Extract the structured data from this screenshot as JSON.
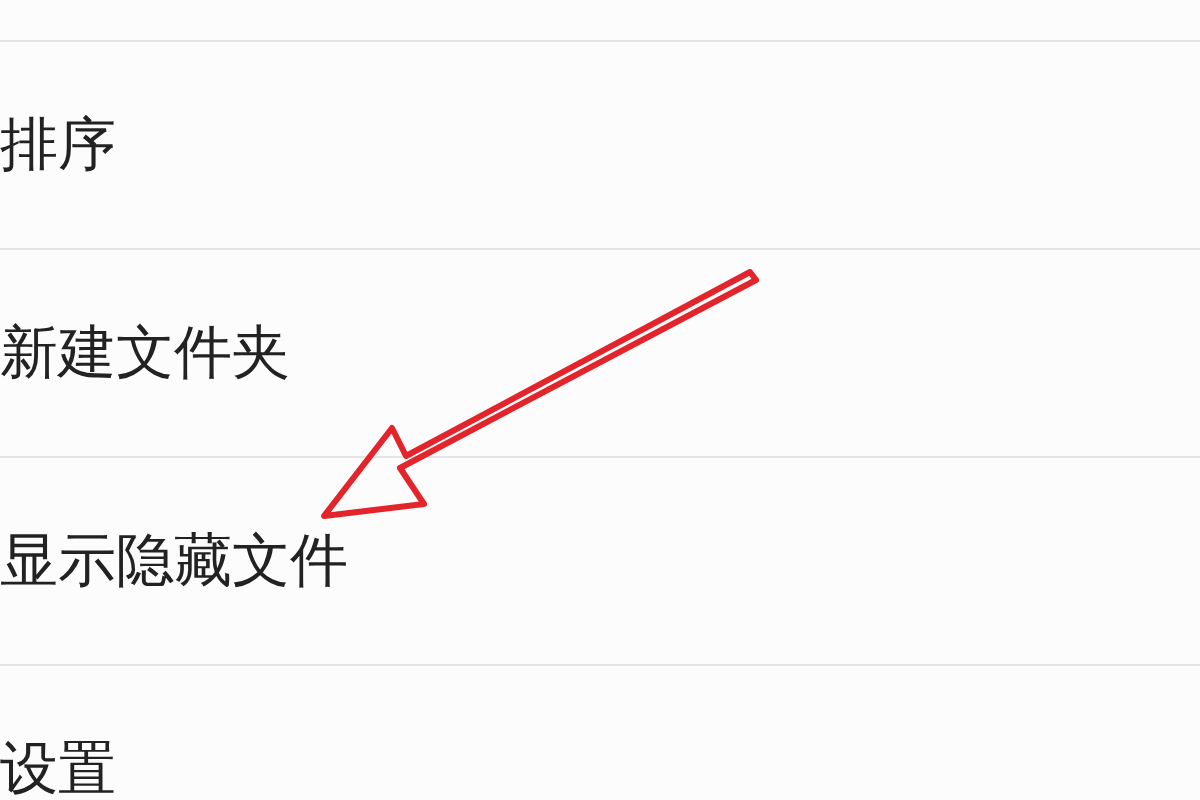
{
  "menu": {
    "items": [
      {
        "label": "排序"
      },
      {
        "label": "新建文件夹"
      },
      {
        "label": "显示隐藏文件"
      },
      {
        "label": "设置"
      }
    ]
  }
}
